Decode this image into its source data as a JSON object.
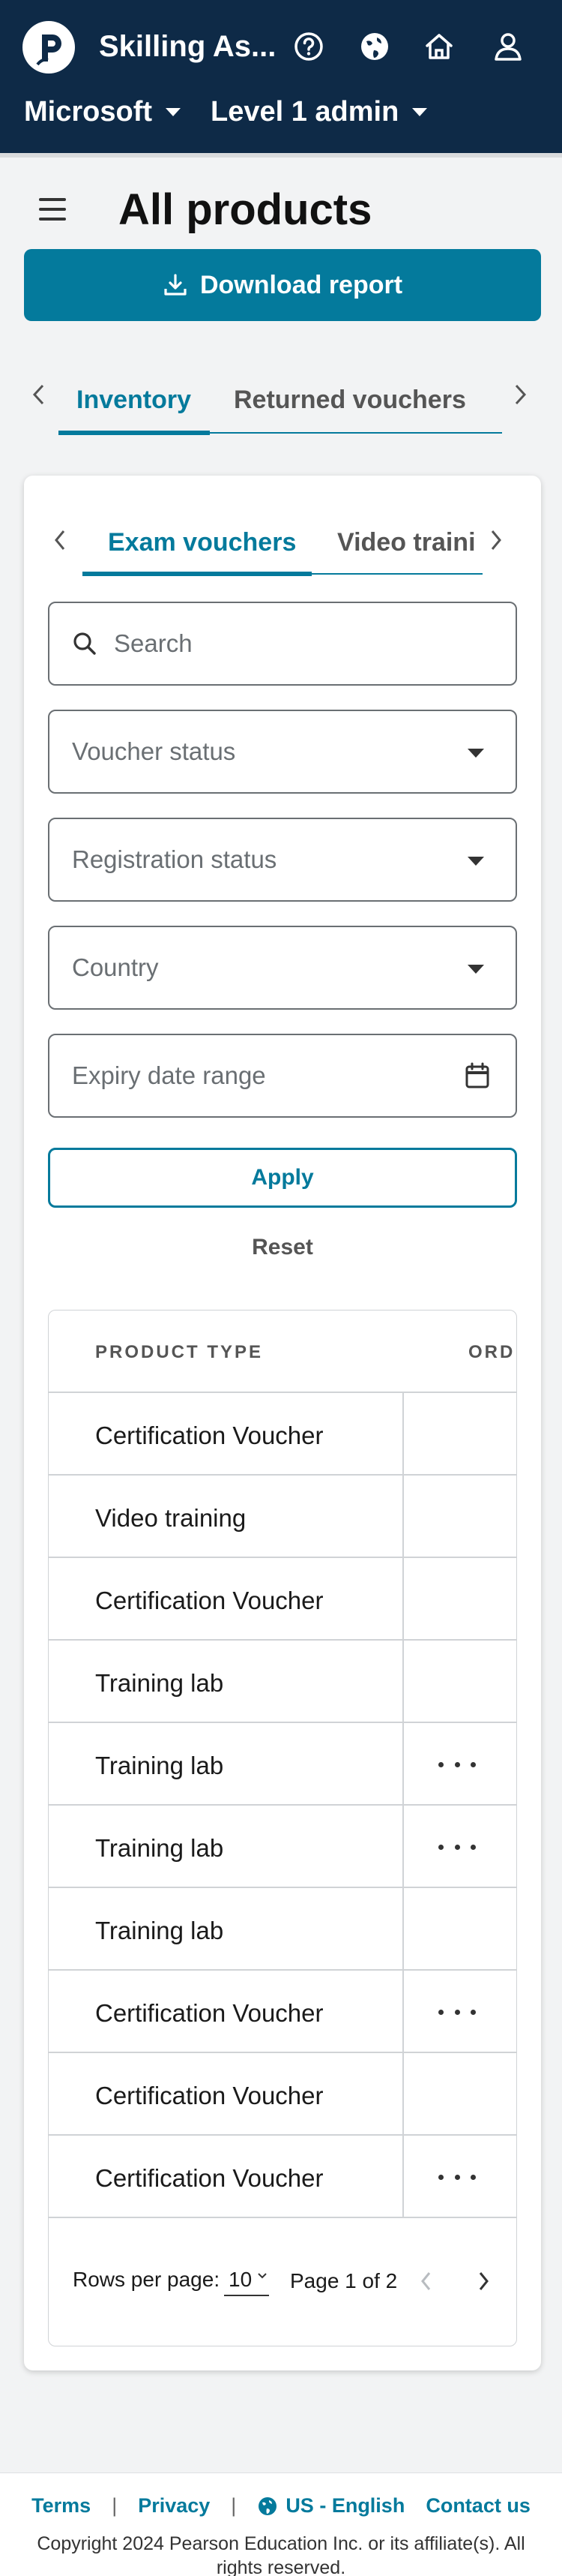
{
  "header": {
    "app_title": "Skilling As...",
    "org_label": "Microsoft",
    "role_label": "Level 1 admin",
    "icons": [
      "help-icon",
      "globe-icon",
      "home-icon",
      "user-icon"
    ]
  },
  "page": {
    "title": "All products",
    "download_label": "Download report"
  },
  "outer_tabs": [
    {
      "label": "Inventory",
      "active": true
    },
    {
      "label": "Returned vouchers",
      "active": false
    }
  ],
  "inner_tabs": [
    {
      "label": "Exam vouchers",
      "active": true
    },
    {
      "label": "Video traini",
      "active": false
    }
  ],
  "filters": {
    "search_placeholder": "Search",
    "voucher_status": "Voucher status",
    "registration_status": "Registration status",
    "country": "Country",
    "expiry_date_range": "Expiry date range",
    "apply_label": "Apply",
    "reset_label": "Reset"
  },
  "table": {
    "headers": [
      "PRODUCT TYPE",
      "ORD"
    ],
    "rows": [
      {
        "product_type": "Certification Voucher",
        "actions": false
      },
      {
        "product_type": "Video training",
        "actions": false
      },
      {
        "product_type": "Certification Voucher",
        "actions": false
      },
      {
        "product_type": "Training lab",
        "actions": false
      },
      {
        "product_type": "Training lab",
        "actions": true
      },
      {
        "product_type": "Training lab",
        "actions": true
      },
      {
        "product_type": "Training lab",
        "actions": false
      },
      {
        "product_type": "Certification Voucher",
        "actions": true
      },
      {
        "product_type": "Certification Voucher",
        "actions": false
      },
      {
        "product_type": "Certification Voucher",
        "actions": true
      }
    ]
  },
  "pagination": {
    "rows_per_page_label": "Rows per page:",
    "rows_per_page_value": "10",
    "page_info": "Page 1 of 2"
  },
  "footer": {
    "terms": "Terms",
    "privacy": "Privacy",
    "language": "US - English",
    "contact": "Contact us",
    "copyright": "Copyright 2024 Pearson Education Inc. or its affiliate(s). All rights reserved."
  },
  "colors": {
    "header_bg": "#0e2a47",
    "accent": "#047a9c"
  }
}
